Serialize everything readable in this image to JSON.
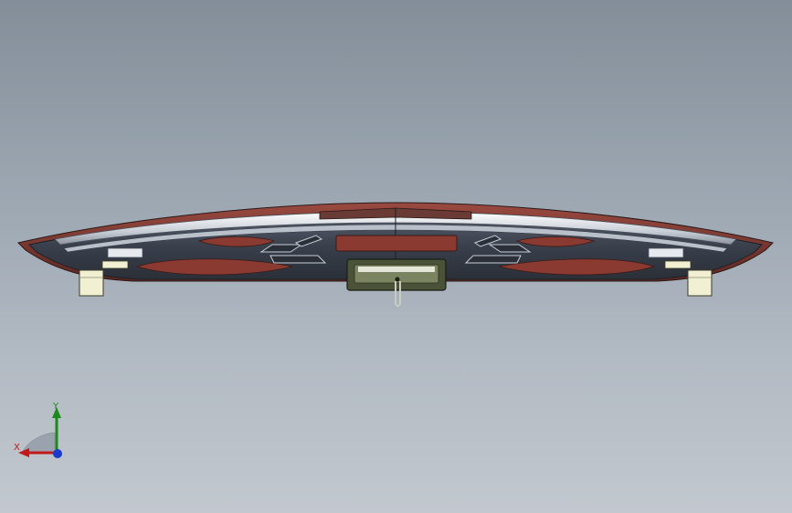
{
  "viewport": {
    "background_top": "#838e99",
    "background_bottom": "#c2c8ce"
  },
  "model": {
    "body_color": "#3d4450",
    "trim_color": "#7a3a32",
    "panel_color": "#8a3a30",
    "rail_color": "#d8dde4",
    "bracket_color": "#f1f0d2"
  },
  "triad": {
    "x_label": "X",
    "y_label": "Y",
    "x_color": "#c21a1a",
    "y_color": "#1a8a1a",
    "z_color": "#1a3acd"
  }
}
